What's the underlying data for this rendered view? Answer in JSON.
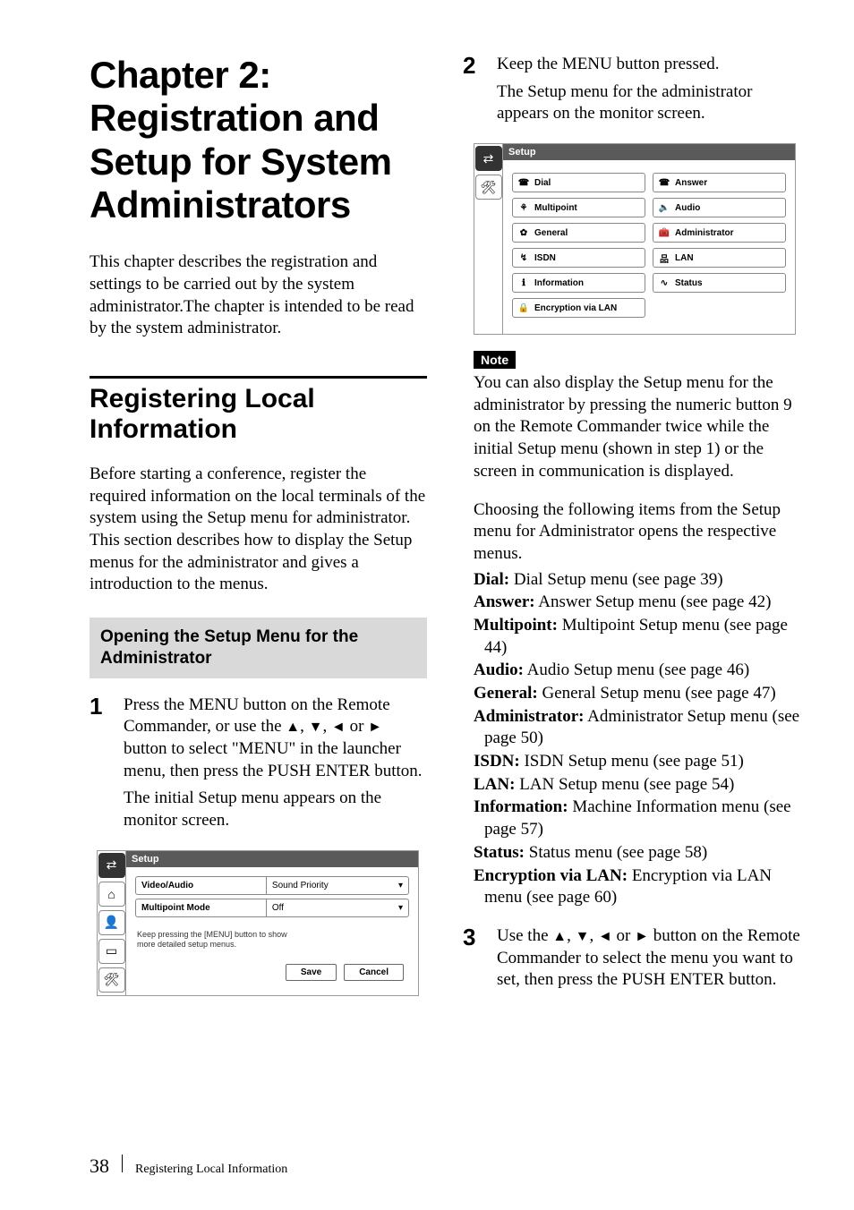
{
  "chapter_title": "Chapter 2: Registration and Setup for System Administrators",
  "intro_para": "This chapter describes the registration and settings to be carried out by the system administrator.The chapter is intended to be read by the system administrator.",
  "section_title": "Registering Local Information",
  "section_para": "Before starting a conference, register the required information on the local terminals of the system using the Setup menu for administrator. This section describes how to display the Setup menus for the administrator and gives a introduction to the menus.",
  "subheading": "Opening the Setup Menu for the Administrator",
  "steps": {
    "s1": {
      "num": "1",
      "p1_a": "Press the  MENU button on the Remote Commander, or use the ",
      "p1_b": ", ",
      "p1_c": ", ",
      "p1_d": " or ",
      "p1_e": " button to select \"MENU\" in the launcher menu, then press the PUSH ENTER button.",
      "p2": "The initial Setup menu appears on the monitor screen."
    },
    "s2": {
      "num": "2",
      "p1": "Keep the MENU button pressed.",
      "p2": "The Setup menu for the administrator appears on the monitor screen."
    },
    "s3": {
      "num": "3",
      "p1_a": "Use the ",
      "p1_b": ", ",
      "p1_c": ", ",
      "p1_d": " or ",
      "p1_e": " button on the Remote Commander to select the menu you want to set, then press the PUSH ENTER button."
    }
  },
  "arrows": {
    "up": "▲",
    "down": "▼",
    "left": "◄",
    "right": "►"
  },
  "note_label": "Note",
  "note_text": "You can also display the Setup menu for the administrator by pressing the numeric button 9 on the Remote Commander twice while the initial Setup menu (shown in step 1) or the screen in communication is displayed.",
  "menu_intro": "Choosing the following items from the Setup menu for Administrator opens the respective menus.",
  "menu_items": [
    {
      "label": "Dial:",
      "desc": " Dial Setup menu (see page 39)"
    },
    {
      "label": "Answer:",
      "desc": " Answer Setup menu (see page 42)"
    },
    {
      "label": "Multipoint:",
      "desc": " Multipoint Setup menu (see page 44)"
    },
    {
      "label": "Audio:",
      "desc": " Audio Setup menu (see page 46)"
    },
    {
      "label": "General:",
      "desc": " General Setup menu (see page 47)"
    },
    {
      "label": "Administrator:",
      "desc": " Administrator Setup menu (see page 50)"
    },
    {
      "label": "ISDN:",
      "desc": " ISDN Setup menu (see page 51)"
    },
    {
      "label": "LAN:",
      "desc": " LAN Setup menu (see page 54)"
    },
    {
      "label": "Information:",
      "desc": " Machine Information menu (see page 57)"
    },
    {
      "label": "Status:",
      "desc": " Status menu (see page 58)"
    },
    {
      "label": "Encryption via LAN:",
      "desc": " Encryption via LAN menu (see page 60)"
    }
  ],
  "fig1": {
    "title": "Setup",
    "rows": [
      {
        "l": "Video/Audio",
        "r": "Sound Priority"
      },
      {
        "l": "Multipoint Mode",
        "r": "Off"
      }
    ],
    "hint1": "Keep pressing the [MENU] button to show",
    "hint2": "more detailed setup menus.",
    "save": "Save",
    "cancel": "Cancel",
    "side_icons": [
      "⇄",
      "⌂",
      "👤",
      "▭",
      "🛠"
    ]
  },
  "fig2": {
    "title": "Setup",
    "side_icons": [
      "⇄",
      "🛠"
    ],
    "cells": [
      {
        "icon": "☎",
        "label": "Dial"
      },
      {
        "icon": "☎",
        "label": "Answer"
      },
      {
        "icon": "⚘",
        "label": "Multipoint"
      },
      {
        "icon": "🔈",
        "label": "Audio"
      },
      {
        "icon": "✿",
        "label": "General"
      },
      {
        "icon": "🧰",
        "label": "Administrator"
      },
      {
        "icon": "↯",
        "label": "ISDN"
      },
      {
        "icon": "品",
        "label": "LAN"
      },
      {
        "icon": "ℹ",
        "label": "Information"
      },
      {
        "icon": "∿",
        "label": "Status"
      },
      {
        "icon": "🔒",
        "label": "Encryption via LAN"
      }
    ]
  },
  "footer": {
    "page": "38",
    "title": "Registering Local Information"
  }
}
